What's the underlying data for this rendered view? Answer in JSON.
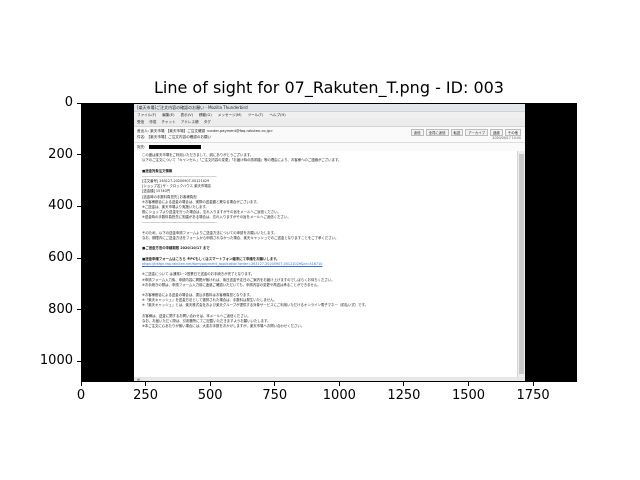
{
  "figure": {
    "title": "Line of sight for 07_Rakuten_T.png - ID: 003",
    "x_ticks": [
      "0",
      "250",
      "500",
      "750",
      "1000",
      "1250",
      "1500",
      "1750"
    ],
    "y_ticks": [
      "0",
      "200",
      "400",
      "600",
      "800",
      "1000"
    ]
  },
  "email": {
    "window_title": "[楽天市場]ご注文内容の確認のお願い - Mozilla Thunderbird",
    "menu": [
      "ファイル(F)",
      "編集(E)",
      "表示(V)",
      "移動(G)",
      "メッセージ(M)",
      "ツール(T)",
      "ヘルプ(H)"
    ],
    "toolbar": [
      "受信",
      "作成",
      "チャット",
      "アドレス帳",
      "タグ"
    ],
    "from": "差出人: 楽天市場 【楽天市場】ご注文確認 <order-payment@faq.rakuten.co.jp>",
    "subject": "件名: 【楽天市場】ご注文内容の確認のお願い",
    "to_label": "宛先:",
    "actions": [
      "返信",
      "全員に返信",
      "転送",
      "アーカイブ",
      "迷惑",
      "その他"
    ],
    "date": "2020/09/17 10:00",
    "body": [
      "この度は楽天市場をご利用いただきまして、誠にありがとうございます。",
      "以下のご注文について「キャンセル」「ご注文内容の変更」「お届け時の請求額」等の理由により、お客様へのご連絡がございます。",
      "",
      "■送金対象注文情報",
      "-------------------------------------------------------------",
      "[注文番号] 263127-20200907-00121029",
      "[ショップ名] ザ・クロックハウス 楽天市場店",
      "[送金額] 15740円",
      "[送金時の手数料負担先] お客様負担",
      "※お客様都合による送金の場合は、実際の送金額と異なる場合がございます。",
      "※ご送金は、楽天市場より実施いたします。",
      "  既にショップより送金を行った場合は、忘れ入りますがその旨をメールへご返信ください。",
      "※送金時の手数料負担先に相違がある場合は、忘れ入りますがその旨をメールへご返信ください。",
      "-------------------------------------------------------------",
      "",
      "そのため、以下の送金申請フォームよりご送金方法についての申請をお願いいたします。",
      "なお、期限内にご送金方法をフォームから申請されなかった場合、楽天キャッシュでのご送金となりますことをご了承ください。",
      "",
      "■ご送金方法の申請期限  2020/10/17 まで",
      "",
      "■送金申請フォームはこちら ※PCもしくはスマートフォン端末にて申請をお願いします。",
      "https://trkfpn.faq.rakuten.net/form/payment_application?order=263127-20200907-00121029&id=416710",
      "",
      "※ご送金について は通常1~2営業日で送金のお手続きが完了となります。",
      "※申請フォーム入力後、申請内容に問題が無ければ、後日送金予定日のご案内をお届け上げますのでしばらくお待ちください。",
      "※お手続きの際は、申請フォーム入力前に迷惑ご確認いただいても、申請内容の変更や再送は承ることができません。",
      "",
      "※お客様都合による送金の場合は、振込手数料はお客様負担となります。",
      "※「楽天キャッシュ」を送金方法として選択された場合は、手数料は発生いたしません。",
      "※「楽天キャッシュ」とは、楽天株式会社および楽天グループが提供する対象サービスにご利用いただけるオンライン電子マネー（前払い式）です。",
      "",
      "お客様は、送金に関するお問い合わせは、本メールへご返信ください。",
      "なお、お届いただく際は、引用箇所にてご記載いただきますようお願いいたします。",
      "※本ご注文に心あたりが無い場合には、大変お手数をおかけしますが、楽天市場へお問い合わせください。"
    ],
    "status": "✉"
  }
}
